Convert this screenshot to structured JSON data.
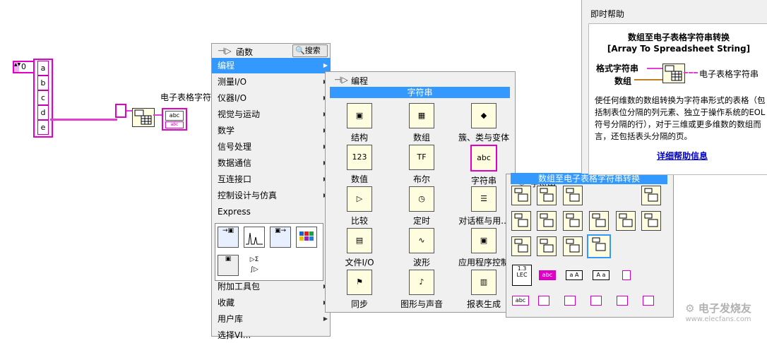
{
  "diagram": {
    "numeric_value": "0",
    "array_items": [
      "a",
      "b",
      "c",
      "d",
      "e"
    ],
    "node_label": "电子表格字符",
    "func_icon_text": "abc",
    "func_icon_text2": "abc"
  },
  "functions_palette": {
    "title": "函数",
    "search_label": "搜索",
    "items": [
      "编程",
      "测量I/O",
      "仪器I/O",
      "视觉与运动",
      "数学",
      "信号处理",
      "数据通信",
      "互连接口",
      "控制设计与仿真",
      "Express",
      "附加工具包",
      "收藏",
      "用户库",
      "选择VI..."
    ],
    "selected_index": 0
  },
  "programming_palette": {
    "title": "编程",
    "highlight": "字符串",
    "cells": [
      "结构",
      "数组",
      "簇、类与变体",
      "数值",
      "布尔",
      "字符串",
      "比较",
      "定时",
      "对话框与用...",
      "文件I/O",
      "波形",
      "应用程序控制",
      "同步",
      "图形与声音",
      "报表生成"
    ]
  },
  "string_palette": {
    "title": "字符串",
    "highlight": "数组至电子表格字符串转换",
    "row4_texts": [
      "1.3 LEC",
      "abc",
      "a A",
      "A a",
      ""
    ],
    "row5_texts": [
      "abc",
      "",
      "",
      "",
      "",
      ""
    ]
  },
  "help": {
    "window_title": "即时帮助",
    "func_title": "数组至电子表格字符串转换",
    "func_subtitle": "[Array To Spreadsheet String]",
    "input1": "格式字符串",
    "input2": "数组",
    "output1": "电子表格字符串",
    "description": "使任何维数的数组转换为字符串形式的表格（包括制表位分隔的列元素、独立于操作系统的EOL符号分隔的行），对于三维或更多维数的数组而言，还包括表头分隔的页。",
    "link": "详细帮助信息"
  },
  "colors": {
    "wire": "#e040d0",
    "selection": "#3399ff"
  },
  "watermark": "电子发烧友 www.elecfans.com"
}
